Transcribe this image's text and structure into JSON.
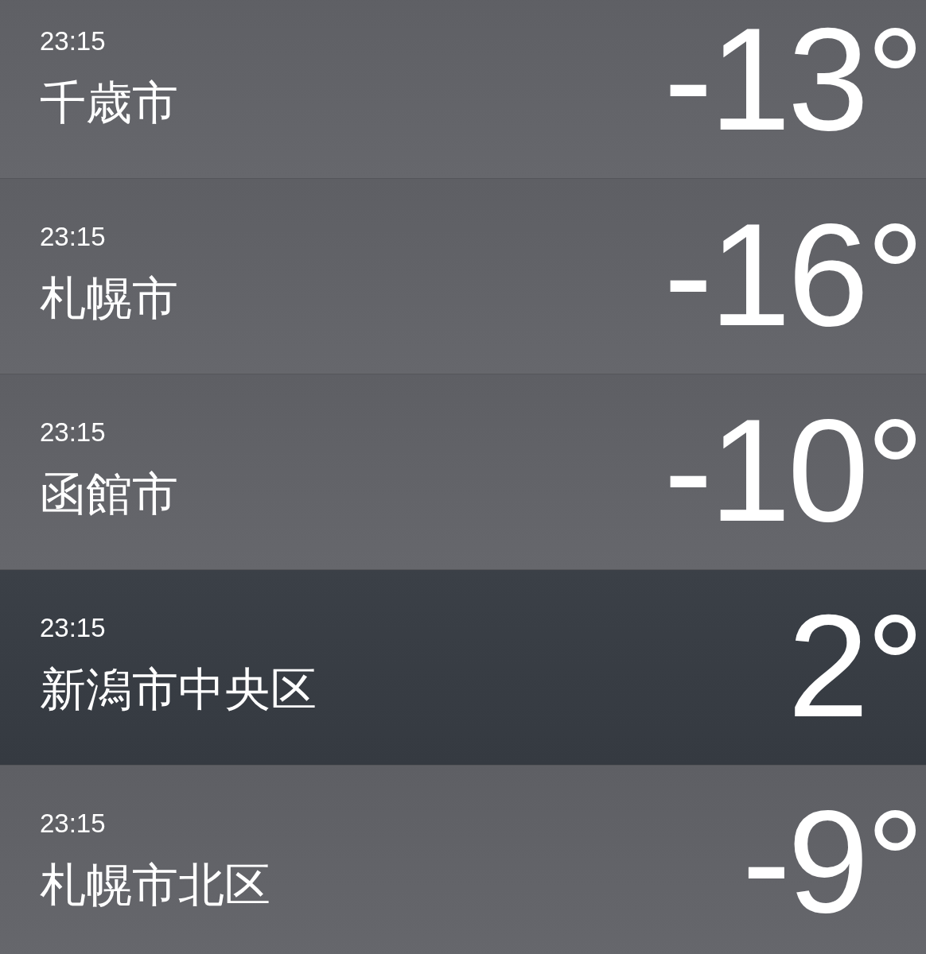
{
  "locations": [
    {
      "time": "23:15",
      "city": "千歳市",
      "temperature": "-13°",
      "kind": "clear"
    },
    {
      "time": "23:15",
      "city": "札幌市",
      "temperature": "-16°",
      "kind": "clear"
    },
    {
      "time": "23:15",
      "city": "函館市",
      "temperature": "-10°",
      "kind": "clear"
    },
    {
      "time": "23:15",
      "city": "新潟市中央区",
      "temperature": "2°",
      "kind": "cloudy"
    },
    {
      "time": "23:15",
      "city": "札幌市北区",
      "temperature": "-9°",
      "kind": "clear"
    }
  ]
}
